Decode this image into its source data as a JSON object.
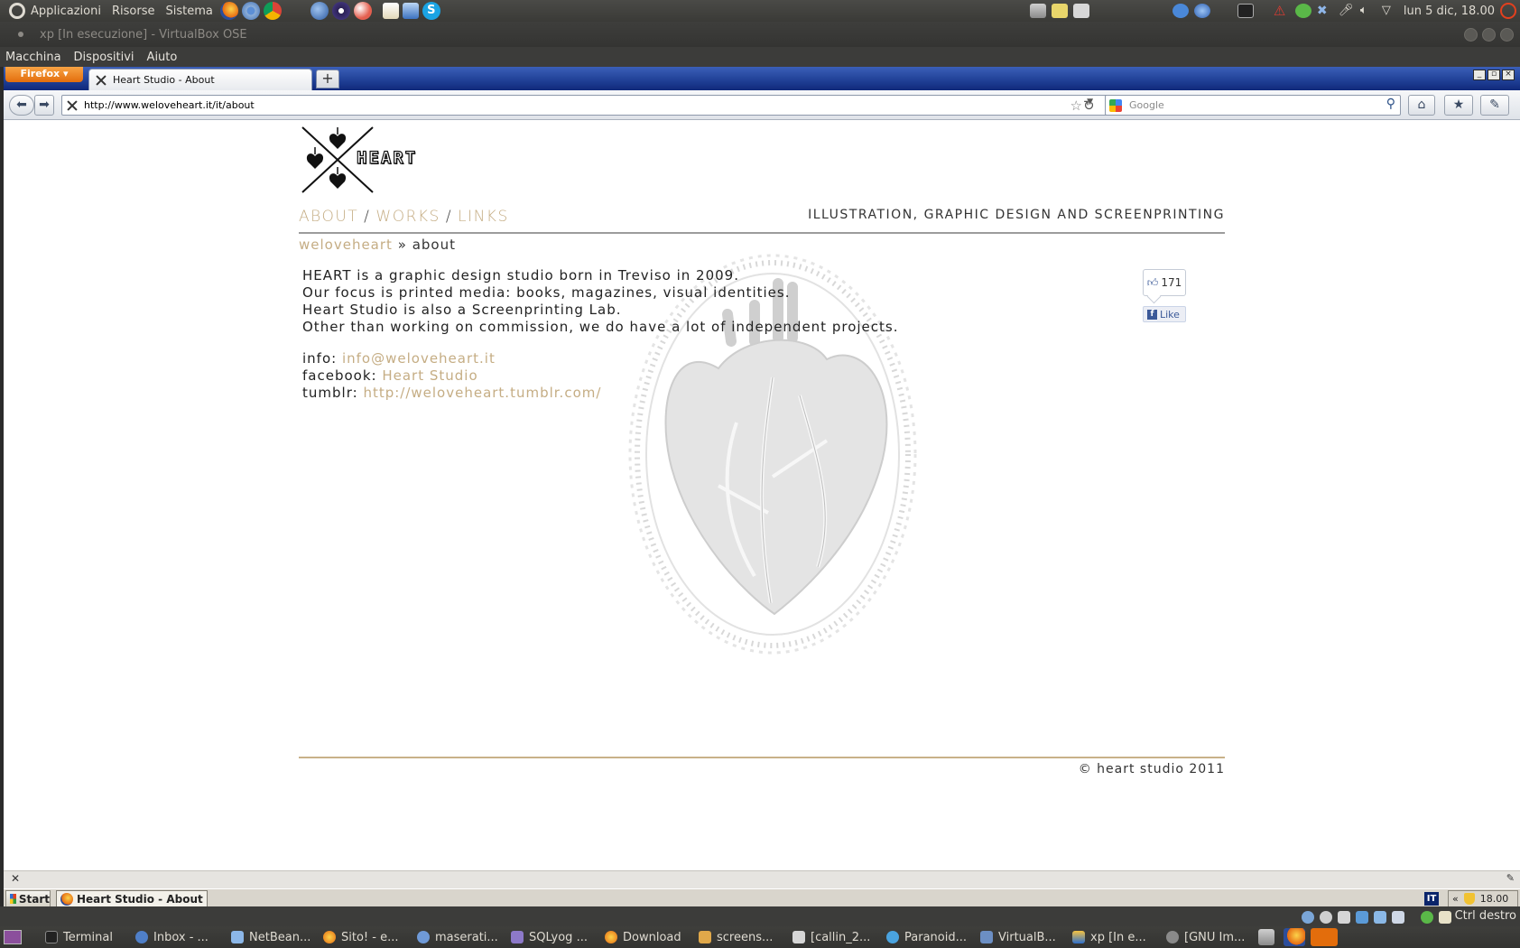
{
  "top_panel": {
    "menus": [
      "Applicazioni",
      "Risorse",
      "Sistema"
    ],
    "clock": "lun  5 dic, 18.00"
  },
  "vbox": {
    "title": "xp [In esecuzione] - VirtualBox OSE",
    "menus": [
      "Macchina",
      "Dispositivi",
      "Aiuto"
    ],
    "host_key": "Ctrl destro"
  },
  "firefox": {
    "button_label": "Firefox",
    "tab_title": "Heart Studio - About",
    "new_tab": "+",
    "url": "http://www.weloveheart.it/it/about",
    "search_placeholder": "Google"
  },
  "site": {
    "logo_text": "HEART",
    "nav": [
      "ABOUT",
      "WORKS",
      "LINKS"
    ],
    "nav_sep": "/",
    "tagline": "ILLUSTRATION, GRAPHIC DESIGN AND SCREENPRINTING",
    "breadcrumb_home": "weloveheart",
    "breadcrumb_sep": "»",
    "breadcrumb_current": "about",
    "paragraphs": [
      "HEART is a graphic design studio born in Treviso in 2009.",
      "Our focus is printed media: books, magazines, visual identities.",
      "Heart Studio is also a Screenprinting Lab.",
      "Other than working on commission, we do have a lot of independent projects."
    ],
    "contacts": [
      {
        "label": "info:",
        "value": "info@weloveheart.it"
      },
      {
        "label": "facebook:",
        "value": "Heart Studio"
      },
      {
        "label": "tumblr:",
        "value": "http://weloveheart.tumblr.com/"
      }
    ],
    "fb_count": "171",
    "fb_like": "Like",
    "copyright": "© heart studio 2011"
  },
  "xp_taskbar": {
    "start": "Start",
    "task": "Heart Studio - About ...",
    "lang": "IT",
    "tray_chevron": "«",
    "clock": "18.00"
  },
  "bottom_panel": {
    "tasks": [
      "Terminal",
      "Inbox - ...",
      "NetBean...",
      "Sito! - e...",
      "maserati...",
      "SQLyog ...",
      "Download",
      "screens...",
      "[callin_2...",
      "Paranoid...",
      "VirtualB...",
      "xp [In e...",
      "[GNU Im..."
    ]
  },
  "colors": {
    "accent_gold": "#c5ad84",
    "firefox_orange": "#e36d0c",
    "facebook_blue": "#3b5998"
  }
}
